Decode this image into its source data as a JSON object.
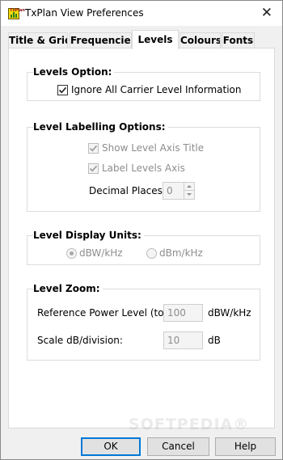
{
  "window": {
    "title": "TxPlan View Preferences",
    "close_glyph": "✕",
    "app_icon": "txplan-app-icon",
    "app_icon_text": "TxPlan"
  },
  "tabs": [
    {
      "label": "Title & Grid",
      "active": false
    },
    {
      "label": "Frequencies",
      "active": false
    },
    {
      "label": "Levels",
      "active": true
    },
    {
      "label": "Colours",
      "active": false
    },
    {
      "label": "Fonts",
      "active": false
    }
  ],
  "levels_option": {
    "title": "Levels Option:",
    "ignore_carrier": {
      "label": "Ignore All Carrier Level Information",
      "checked": true,
      "enabled": true
    }
  },
  "labelling": {
    "title": "Level Labelling Options:",
    "show_axis_title": {
      "label": "Show Level Axis Title",
      "checked": true,
      "enabled": false
    },
    "label_levels_axis": {
      "label": "Label Levels Axis",
      "checked": true,
      "enabled": false
    },
    "decimal_places": {
      "label": "Decimal Places:",
      "value": "0"
    }
  },
  "display_units": {
    "title": "Level Display Units:",
    "options": [
      {
        "label": "dBW/kHz",
        "selected": true,
        "enabled": false
      },
      {
        "label": "dBm/kHz",
        "selected": false,
        "enabled": false
      }
    ]
  },
  "zoom": {
    "title": "Level Zoom:",
    "reference": {
      "label": "Reference Power Level (top):",
      "value": "100",
      "unit": "dBW/kHz"
    },
    "scale": {
      "label": "Scale dB/division:",
      "value": "10",
      "unit": "dB"
    }
  },
  "buttons": {
    "ok": "OK",
    "cancel": "Cancel",
    "help": "Help"
  },
  "watermark": "SOFTPEDIA®",
  "colors": {
    "default_button_border": "#0078d7",
    "disabled_text": "#8d8d8d",
    "panel_bg": "#ffffff",
    "dialog_bg": "#f0f0f0"
  }
}
